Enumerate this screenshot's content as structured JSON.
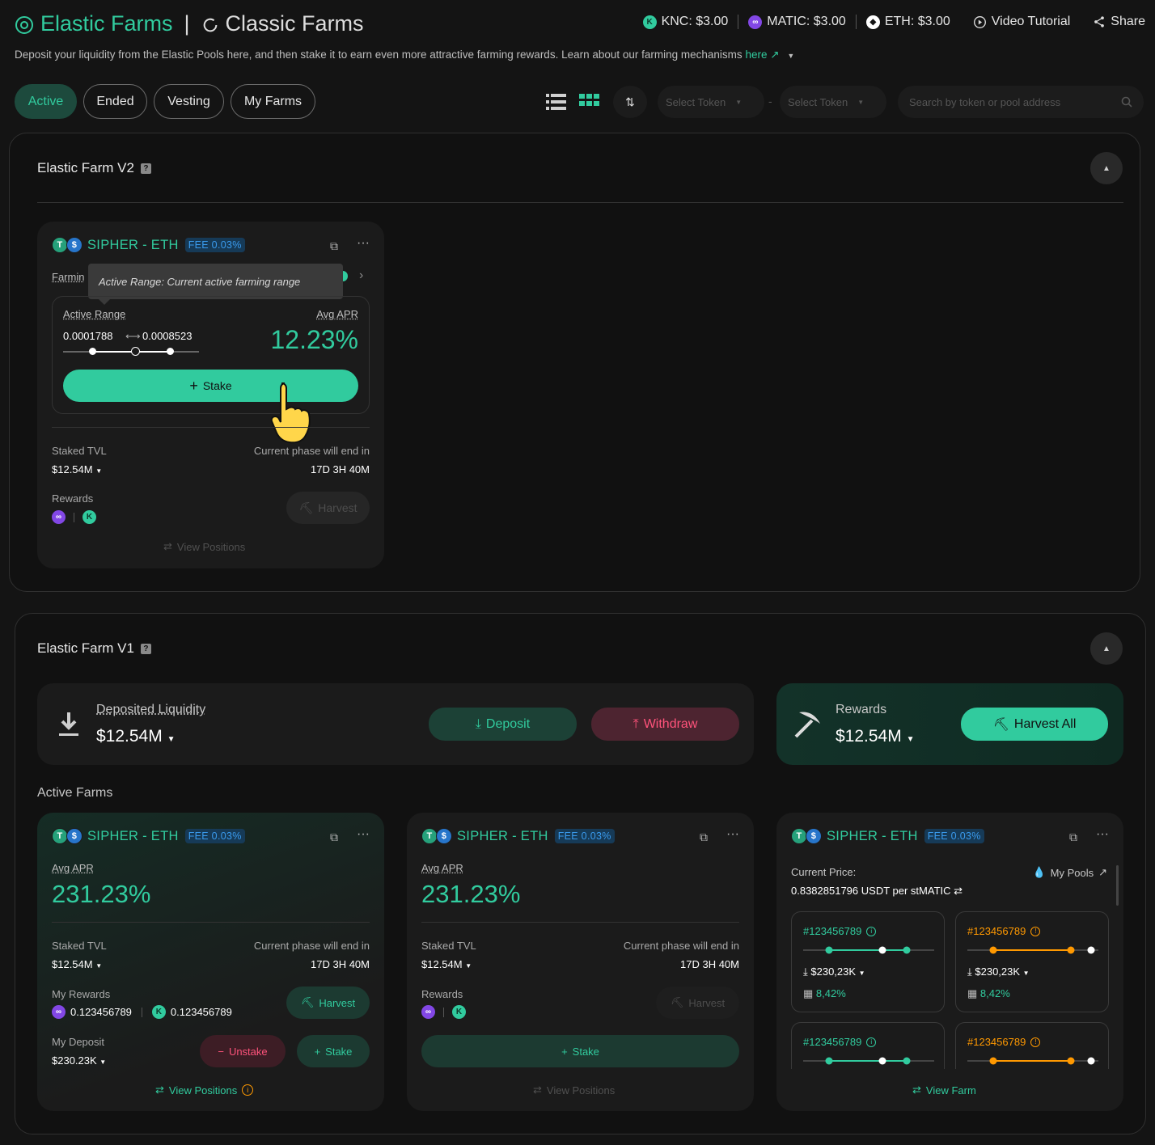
{
  "header": {
    "elastic_label": "Elastic Farms",
    "divider": "|",
    "classic_label": "Classic Farms",
    "prices": [
      {
        "token": "knc",
        "text": "KNC: $3.00"
      },
      {
        "token": "matic",
        "text": "MATIC: $3.00"
      },
      {
        "token": "eth",
        "text": "ETH: $3.00"
      }
    ],
    "video_tutorial": "Video Tutorial",
    "share": "Share"
  },
  "description": {
    "text": "Deposit your liquidity from the Elastic Pools here, and then stake it to earn even more attractive farming rewards. Learn about our farming mechanisms",
    "link": "here"
  },
  "filters": {
    "tabs": [
      "Active",
      "Ended",
      "Vesting",
      "My Farms"
    ],
    "active_tab": "Active",
    "select_token_1": "Select Token",
    "dash": "-",
    "select_token_2": "Select Token",
    "search_placeholder": "Search by token or pool address"
  },
  "v2": {
    "title": "Elastic Farm V2",
    "card": {
      "pair": "SIPHER - ETH",
      "fee": "FEE 0.03%",
      "farming_label": "Farmin",
      "tooltip": "Active Range: Current active farming range",
      "active_range_label": "Active Range",
      "range_min": "0.0001788",
      "range_arrow": "⟷",
      "range_max": "0.0008523",
      "avg_apr_label": "Avg APR",
      "avg_apr": "12.23%",
      "stake": "Stake",
      "staked_tvl_label": "Staked TVL",
      "staked_tvl": "$12.54M",
      "phase_label": "Current phase will end in",
      "phase": "17D 3H 40M",
      "rewards_label": "Rewards",
      "harvest": "Harvest",
      "view_positions": "View Positions"
    }
  },
  "v1": {
    "title": "Elastic Farm V1",
    "deposited_label": "Deposited Liquidity",
    "deposited_value": "$12.54M",
    "deposit": "Deposit",
    "withdraw": "Withdraw",
    "rewards_label": "Rewards",
    "rewards_value": "$12.54M",
    "harvest_all": "Harvest All",
    "active_farms_label": "Active Farms",
    "card1": {
      "pair": "SIPHER - ETH",
      "fee": "FEE 0.03%",
      "avg_apr_label": "Avg APR",
      "avg_apr": "231.23%",
      "staked_tvl_label": "Staked TVL",
      "staked_tvl": "$12.54M",
      "phase_label": "Current phase will end in",
      "phase": "17D 3H 40M",
      "my_rewards_label": "My Rewards",
      "reward_1": "0.123456789",
      "reward_2": "0.123456789",
      "harvest": "Harvest",
      "my_deposit_label": "My Deposit",
      "my_deposit": "$230.23K",
      "unstake": "Unstake",
      "stake": "Stake",
      "view_positions": "View Positions"
    },
    "card2": {
      "pair": "SIPHER - ETH",
      "fee": "FEE 0.03%",
      "avg_apr_label": "Avg APR",
      "avg_apr": "231.23%",
      "staked_tvl_label": "Staked TVL",
      "staked_tvl": "$12.54M",
      "phase_label": "Current phase will end in",
      "phase": "17D 3H 40M",
      "rewards_label": "Rewards",
      "harvest": "Harvest",
      "stake": "Stake",
      "view_positions": "View Positions"
    },
    "card3": {
      "pair": "SIPHER - ETH",
      "fee": "FEE 0.03%",
      "current_price_label": "Current Price:",
      "my_pools": "My Pools",
      "current_price": "0.8382851796 USDT per stMATIC",
      "positions": [
        {
          "id": "#123456789",
          "status": "in-range",
          "value": "$230,23K",
          "apr": "8,42%"
        },
        {
          "id": "#123456789",
          "status": "out-of-range",
          "value": "$230,23K",
          "apr": "8,42%"
        },
        {
          "id": "#123456789",
          "status": "in-range"
        },
        {
          "id": "#123456789",
          "status": "out-of-range"
        }
      ],
      "view_farm": "View Farm"
    }
  },
  "colors": {
    "accent": "#31cb9e",
    "warning": "#ff9901",
    "danger": "#ff537b",
    "fee": "#3a9bee"
  }
}
